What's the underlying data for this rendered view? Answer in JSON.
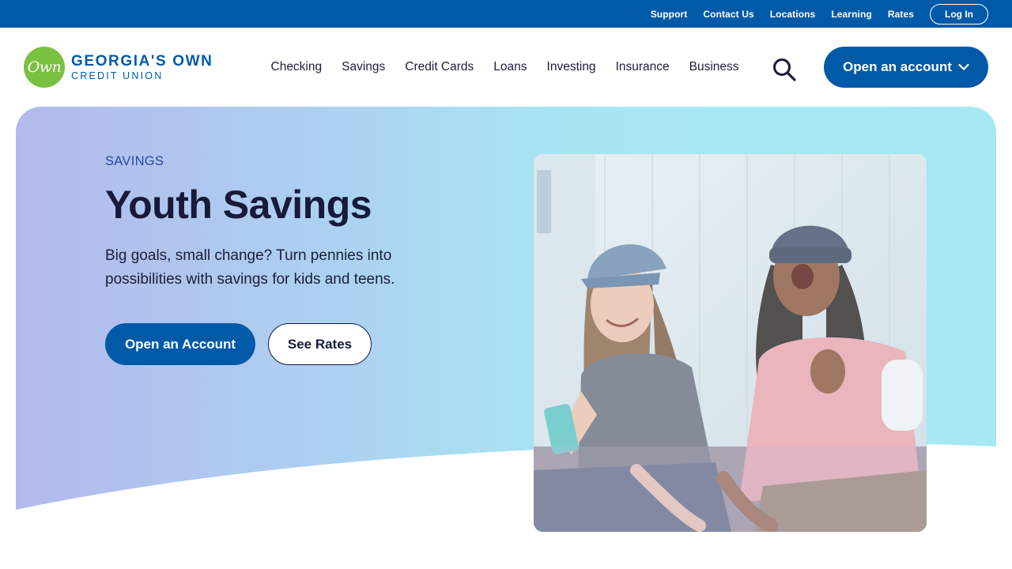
{
  "utility_nav": {
    "links": [
      "Support",
      "Contact Us",
      "Locations",
      "Learning",
      "Rates"
    ],
    "login_label": "Log In"
  },
  "brand": {
    "mark_text": "Own",
    "name_line1": "GEORGIA'S OWN",
    "name_line2": "CREDIT UNION",
    "colors": {
      "primary": "#005aa8",
      "green": "#7ac142",
      "dark": "#171a3a"
    }
  },
  "main_nav": {
    "items": [
      "Checking",
      "Savings",
      "Credit Cards",
      "Loans",
      "Investing",
      "Insurance",
      "Business"
    ],
    "search_icon": "search-icon",
    "cta_label": "Open an account"
  },
  "hero": {
    "eyebrow": "SAVINGS",
    "title": "Youth Savings",
    "description": "Big goals, small change? Turn pennies into possibilities with savings for kids and teens.",
    "primary_button": "Open an Account",
    "secondary_button": "See Rates"
  }
}
